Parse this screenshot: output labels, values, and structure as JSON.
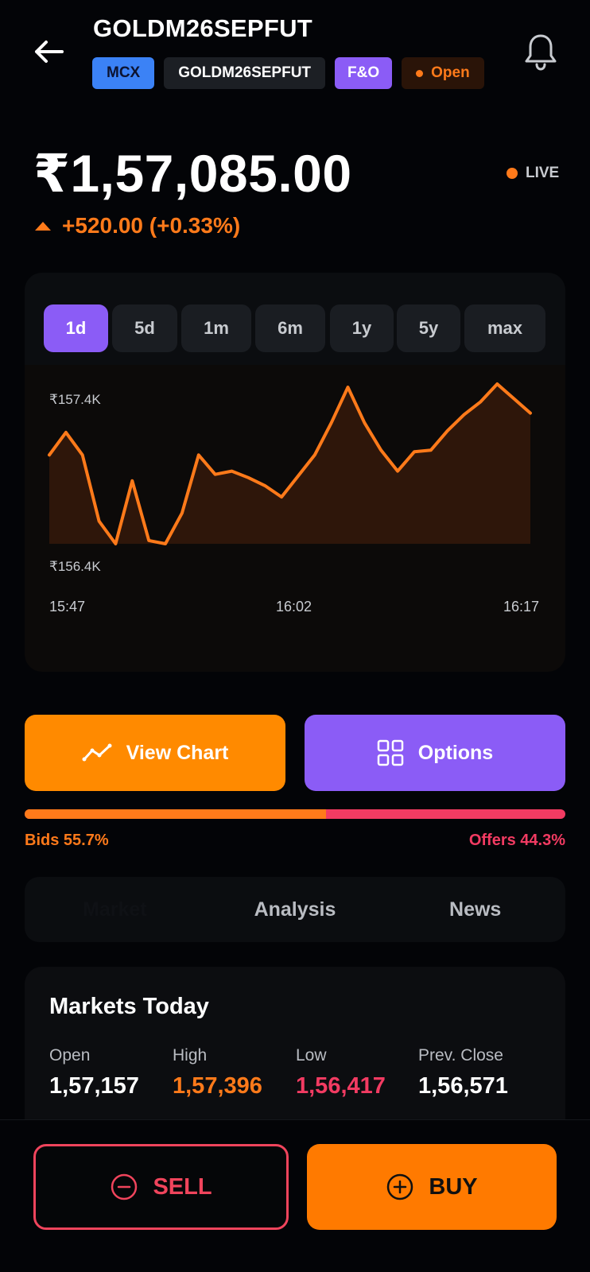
{
  "header": {
    "title": "GOLDM26SEPFUT",
    "badges": {
      "exchange": "MCX",
      "symbol": "GOLDM26SEPFUT",
      "segment": "F&O",
      "status": "Open"
    }
  },
  "quote": {
    "price": "₹1,57,085.00",
    "change": "+520.00 (+0.33%)",
    "live_label": "LIVE"
  },
  "colors": {
    "accent_orange": "#ff7a1a",
    "accent_purple": "#8b5cf6",
    "sell_red": "#f0445c",
    "exchange_blue": "#3b82f6"
  },
  "timeframes": [
    "1d",
    "5d",
    "1m",
    "6m",
    "1y",
    "5y",
    "max"
  ],
  "active_timeframe": "1d",
  "chart_data": {
    "type": "area",
    "y_labels": {
      "top": "₹157.4K",
      "bottom": "₹156.4K"
    },
    "x_labels": [
      "15:47",
      "16:02",
      "16:17"
    ],
    "ylim": [
      156400,
      157400
    ],
    "baseline": 156400,
    "values": [
      156950,
      157090,
      156950,
      156540,
      156400,
      156790,
      156420,
      156400,
      156590,
      156950,
      156830,
      156850,
      156810,
      156760,
      156690,
      156820,
      156950,
      157150,
      157370,
      157150,
      156980,
      156850,
      156970,
      156980,
      157100,
      157200,
      157280,
      157390,
      157300,
      157210
    ]
  },
  "actions": {
    "view_chart": "View Chart",
    "options": "Options"
  },
  "order_book": {
    "bids_label": "Bids 55.7%",
    "offers_label": "Offers 44.3%",
    "bids_pct": 55.7
  },
  "tabs": [
    {
      "label": "Market",
      "active": true
    },
    {
      "label": "Analysis",
      "active": false
    },
    {
      "label": "News",
      "active": false
    }
  ],
  "markets_today": {
    "title": "Markets Today",
    "stats": [
      {
        "label": "Open",
        "value": "1,57,157",
        "color": "#ffffff"
      },
      {
        "label": "High",
        "value": "1,57,396",
        "color": "#ff7a1a"
      },
      {
        "label": "Low",
        "value": "1,56,417",
        "color": "#f23b62"
      },
      {
        "label": "Prev. Close",
        "value": "1,56,571",
        "color": "#ffffff"
      }
    ]
  },
  "trade": {
    "sell": "SELL",
    "buy": "BUY"
  }
}
